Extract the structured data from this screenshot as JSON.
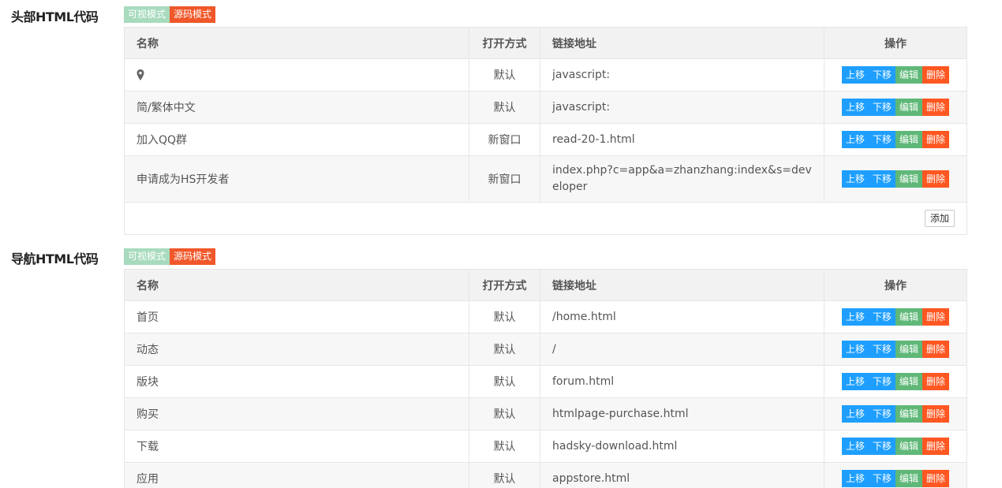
{
  "header_section": {
    "title": "头部HTML代码",
    "mode_visual": "可视模式",
    "mode_source": "源码模式",
    "columns": {
      "name": "名称",
      "open": "打开方式",
      "url": "链接地址",
      "ops": "操作"
    },
    "rows": [
      {
        "name": "",
        "icon": "map-pin-icon",
        "open": "默认",
        "url": "javascript:"
      },
      {
        "name": "简/繁体中文",
        "open": "默认",
        "url": "javascript:"
      },
      {
        "name": "加入QQ群",
        "open": "新窗口",
        "url": "read-20-1.html"
      },
      {
        "name": "申请成为HS开发者",
        "open": "新窗口",
        "url": "index.php?c=app&a=zhanzhang:index&s=developer"
      }
    ],
    "add_label": "添加"
  },
  "nav_section": {
    "title": "导航HTML代码",
    "mode_visual": "可视模式",
    "mode_source": "源码模式",
    "columns": {
      "name": "名称",
      "open": "打开方式",
      "url": "链接地址",
      "ops": "操作"
    },
    "rows": [
      {
        "name": "首页",
        "open": "默认",
        "url": "/home.html"
      },
      {
        "name": "动态",
        "open": "默认",
        "url": "/"
      },
      {
        "name": "版块",
        "open": "默认",
        "url": "forum.html"
      },
      {
        "name": "购买",
        "open": "默认",
        "url": "htmlpage-purchase.html"
      },
      {
        "name": "下载",
        "open": "默认",
        "url": "hadsky-download.html"
      },
      {
        "name": "应用",
        "open": "默认",
        "url": "appstore.html"
      }
    ]
  },
  "ops": {
    "up": "上移",
    "down": "下移",
    "edit": "编辑",
    "delete": "删除"
  },
  "colors": {
    "up": "#1e9fff",
    "down": "#1e9fff",
    "edit": "#5fb878",
    "delete": "#ff5722",
    "visual_mode": "#a8dbbe",
    "source_mode": "#f0572a",
    "link": "#1e7fc7"
  }
}
